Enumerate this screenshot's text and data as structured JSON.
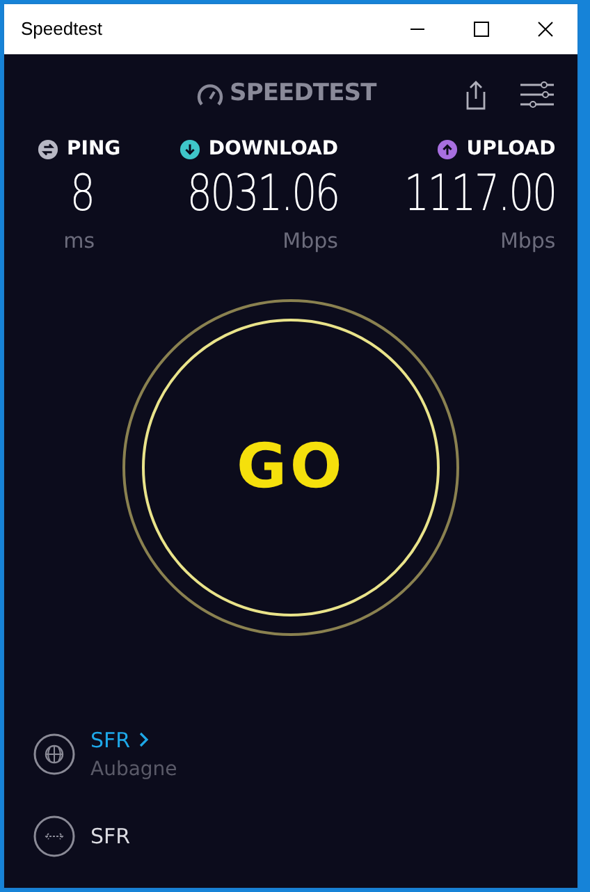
{
  "window": {
    "title": "Speedtest"
  },
  "brand": "SPEEDTEST",
  "metrics": [
    {
      "kind": "ping",
      "label": "PING",
      "value": "8",
      "unit": "ms"
    },
    {
      "kind": "download",
      "label": "DOWNLOAD",
      "value": "8031.06",
      "unit": "Mbps"
    },
    {
      "kind": "upload",
      "label": "UPLOAD",
      "value": "1117.00",
      "unit": "Mbps"
    }
  ],
  "go_button": "GO",
  "server": {
    "name": "SFR",
    "location": "Aubagne"
  },
  "provider": {
    "name": "SFR"
  }
}
